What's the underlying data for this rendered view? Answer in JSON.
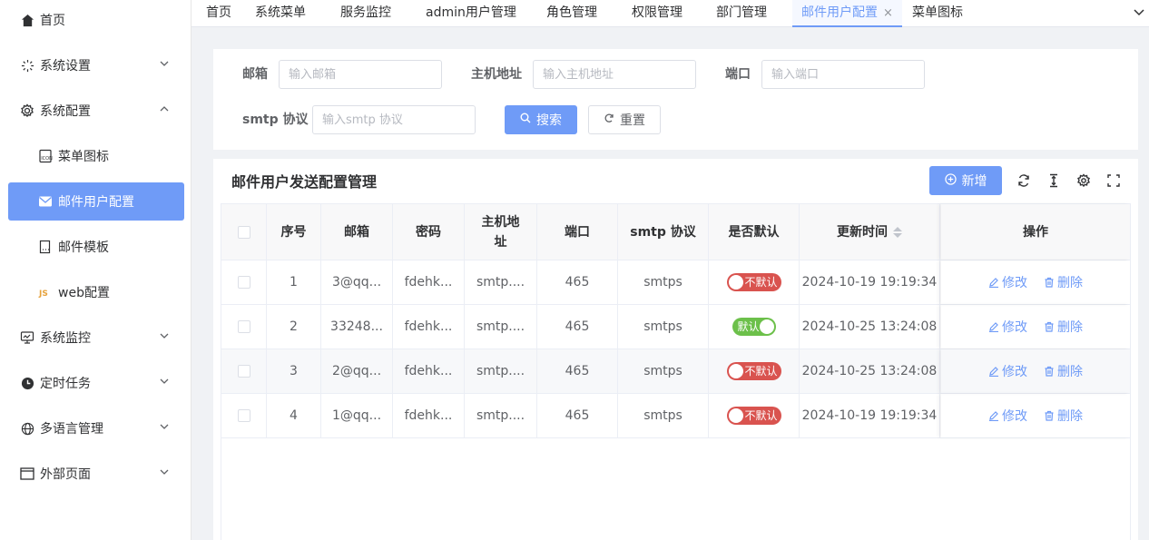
{
  "sidebar": {
    "items": [
      {
        "label": "首页",
        "icon": "home-icon",
        "expanded": null
      },
      {
        "label": "系统设置",
        "icon": "settings-icon",
        "expanded": false
      },
      {
        "label": "系统配置",
        "icon": "gear-icon",
        "expanded": true
      },
      {
        "label": "菜单图标",
        "icon": "icon-icon",
        "sub": true
      },
      {
        "label": "邮件用户配置",
        "icon": "mail-icon",
        "sub": true,
        "active": true
      },
      {
        "label": "邮件模板",
        "icon": "template-icon",
        "sub": true
      },
      {
        "label": "web配置",
        "icon": "js-icon",
        "sub": true
      },
      {
        "label": "系统监控",
        "icon": "monitor-icon",
        "expanded": false
      },
      {
        "label": "定时任务",
        "icon": "clock-icon",
        "expanded": false
      },
      {
        "label": "多语言管理",
        "icon": "globe-icon",
        "expanded": false
      },
      {
        "label": "外部页面",
        "icon": "window-icon",
        "expanded": false
      }
    ]
  },
  "tabs": [
    {
      "label": "首页"
    },
    {
      "label": "系统菜单"
    },
    {
      "label": "服务监控"
    },
    {
      "label": "admin用户管理"
    },
    {
      "label": "角色管理"
    },
    {
      "label": "权限管理"
    },
    {
      "label": "部门管理"
    },
    {
      "label": "邮件用户配置",
      "active": true,
      "close": "×"
    },
    {
      "label": "菜单图标"
    }
  ],
  "search": {
    "email_label": "邮箱",
    "email_placeholder": "输入邮箱",
    "host_label": "主机地址",
    "host_placeholder": "输入主机地址",
    "port_label": "端口",
    "port_placeholder": "输入端口",
    "smtp_label": "smtp 协议",
    "smtp_placeholder": "输入smtp 协议",
    "search_button": "搜索",
    "reset_button": "重置"
  },
  "panel": {
    "title": "邮件用户发送配置管理",
    "add_button": "新增"
  },
  "table": {
    "headers": [
      "序号",
      "邮箱",
      "密码",
      "主机地址",
      "端口",
      "smtp 协议",
      "是否默认",
      "更新时间",
      "操作"
    ],
    "rows": [
      {
        "index": "1",
        "email": "3@qq...",
        "password": "fdehk...",
        "host": "smtp....",
        "port": "465",
        "smtp": "smtps",
        "is_default": false,
        "default_label": "不默认",
        "updated": "2024-10-19 19:19:34",
        "edit": "修改",
        "delete": "删除"
      },
      {
        "index": "2",
        "email": "33248...",
        "password": "fdehk...",
        "host": "smtp....",
        "port": "465",
        "smtp": "smtps",
        "is_default": true,
        "default_label": "默认",
        "updated": "2024-10-25 13:24:08",
        "edit": "修改",
        "delete": "删除"
      },
      {
        "index": "3",
        "email": "2@qq...",
        "password": "fdehk...",
        "host": "smtp....",
        "port": "465",
        "smtp": "smtps",
        "is_default": false,
        "default_label": "不默认",
        "updated": "2024-10-25 13:24:08",
        "edit": "修改",
        "delete": "删除"
      },
      {
        "index": "4",
        "email": "1@qq...",
        "password": "fdehk...",
        "host": "smtp....",
        "port": "465",
        "smtp": "smtps",
        "is_default": false,
        "default_label": "不默认",
        "updated": "2024-10-19 19:19:34",
        "edit": "修改",
        "delete": "删除"
      }
    ]
  },
  "colors": {
    "accent": "#6f9bf7",
    "switch_off": "#d9534f",
    "switch_on": "#6cc04a"
  }
}
